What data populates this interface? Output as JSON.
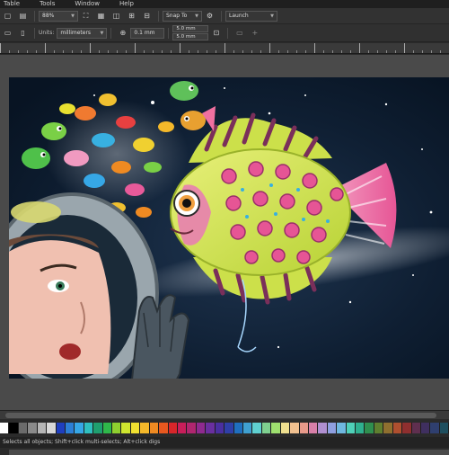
{
  "menubar": {
    "items": [
      "Table",
      "Tools",
      "Window",
      "Help"
    ]
  },
  "toolbar1": {
    "zoom_value": "88%",
    "snap_to_label": "Snap To",
    "launch_label": "Launch"
  },
  "toolbar2": {
    "units_label": "Units:",
    "units_value": "millimeters",
    "nudge_value": "0.1 mm",
    "dup_x": "5.0 mm",
    "dup_y": "5.0 mm"
  },
  "status": {
    "hint": "Selects all objects; Shift+click multi-selects; Alt+click digs"
  },
  "palette": {
    "colors": [
      "#ffffff",
      "#000000",
      "#6b6b6b",
      "#8a8a8a",
      "#b5b5b5",
      "#d8d8d8",
      "#1f3fbf",
      "#2c7fd6",
      "#36a7e6",
      "#2fbfbf",
      "#1f9f6f",
      "#2fb84a",
      "#8fcf2f",
      "#cfe62f",
      "#f0e030",
      "#f4b82a",
      "#ef8a22",
      "#e8581f",
      "#d8262a",
      "#c81e5a",
      "#b0266f",
      "#8f2a8f",
      "#6a2f9f",
      "#4a2fa0",
      "#2f3fa8",
      "#1f6fbf",
      "#3fa0d0",
      "#5fd0d0",
      "#7fd08f",
      "#9fe06f",
      "#efe08f",
      "#f0c08f",
      "#e89a8a",
      "#d87fa8",
      "#b08fd0",
      "#8f9fe0",
      "#6fb8e0",
      "#4fd0b8",
      "#2fb08f",
      "#2f8f4f",
      "#5f7f2f",
      "#8f6f2f",
      "#af4f2f",
      "#8f2f2f",
      "#5f2f4f",
      "#3f2f5f",
      "#2f3f6f",
      "#1f4f5f"
    ]
  }
}
